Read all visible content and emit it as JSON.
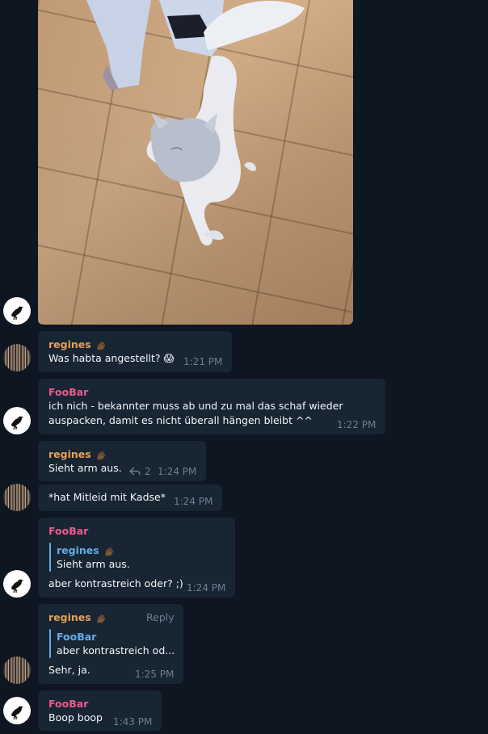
{
  "messages": {
    "m1": {
      "sender": "regines",
      "text": "Was habta angestellt? 😱",
      "time": "1:21 PM"
    },
    "m2": {
      "sender": "FooBar",
      "line1": "ich nich - bekannter muss ab und zu mal das schaf wieder",
      "line2": "auspacken, damit es nicht überall hängen bleibt ^^",
      "time": "1:22 PM"
    },
    "m3": {
      "sender": "regines",
      "text": "Sieht arm aus.",
      "reply_count": "2",
      "time": "1:24 PM"
    },
    "m4": {
      "text": "*hat Mitleid mit Kadse*",
      "time": "1:24 PM"
    },
    "m5": {
      "sender": "FooBar",
      "quote_sender": "regines",
      "quote_text": "Sieht arm aus.",
      "text": "aber kontrastreich oder? ;)",
      "time": "1:24 PM"
    },
    "m6": {
      "sender": "regines",
      "reply_label": "Reply",
      "quote_sender": "FooBar",
      "quote_text": "aber kontrastreich od...",
      "text": "Sehr, ja.",
      "time": "1:25 PM"
    },
    "m7": {
      "sender": "FooBar",
      "text": "Boop boop",
      "time": "1:43 PM"
    }
  },
  "colors": {
    "background": "#0e1621",
    "bubble": "#182533",
    "name_orange": "#e5a155",
    "name_pink": "#ee5a8f",
    "name_blue": "#63aee8",
    "timestamp": "#6d7f8f"
  },
  "icons": {
    "bird_avatar": "bird-avatar-icon",
    "tree_avatar": "trees-avatar-icon",
    "hand_emoji": "waving-hand-icon",
    "reply_arrow": "reply-arrow-icon"
  }
}
